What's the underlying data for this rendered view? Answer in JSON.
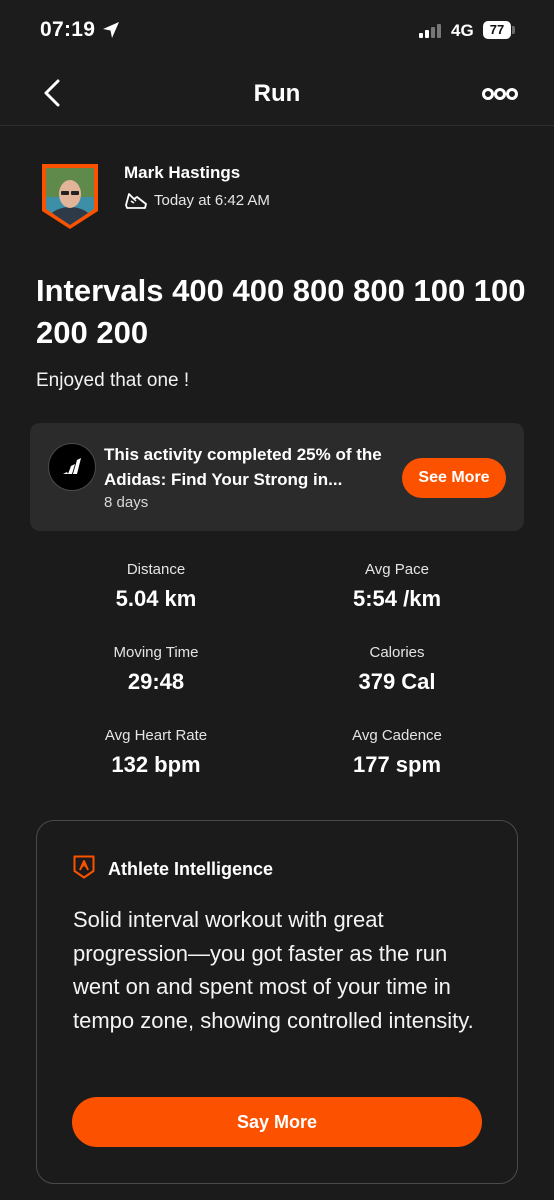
{
  "status_bar": {
    "time": "07:19",
    "network": "4G",
    "battery": "77",
    "icons": [
      "location-arrow-icon",
      "signal-bars-icon"
    ]
  },
  "nav": {
    "title": "Run",
    "back_icon": "chevron-left-icon",
    "more_icon": "more-options-icon"
  },
  "athlete": {
    "name": "Mark Hastings",
    "timestamp": "Today at 6:42 AM",
    "activity_icon": "running-shoe-icon"
  },
  "activity": {
    "title": "Intervals 400 400 800 800 100 100 200 200",
    "description": "Enjoyed that one !"
  },
  "challenge": {
    "text": "This activity completed 25% of the Adidas: Find Your Strong in...",
    "days": "8 days",
    "button_label": "See More",
    "logo_icon": "adidas-logo-icon"
  },
  "stats": [
    {
      "label": "Distance",
      "value": "5.04 km"
    },
    {
      "label": "Avg Pace",
      "value": "5:54 /km"
    },
    {
      "label": "Moving Time",
      "value": "29:48"
    },
    {
      "label": "Calories",
      "value": "379 Cal"
    },
    {
      "label": "Avg Heart Rate",
      "value": "132 bpm"
    },
    {
      "label": "Avg Cadence",
      "value": "177 spm"
    }
  ],
  "athlete_intelligence": {
    "title": "Athlete Intelligence",
    "summary": "Solid interval workout with great progression—you got faster as the run went on and spent most of your time in tempo zone, showing controlled intensity.",
    "button_label": "Say More",
    "icon": "athlete-intelligence-icon"
  },
  "colors": {
    "accent": "#fc5200",
    "background": "#1b1b1b",
    "card": "#2b2b2b"
  }
}
